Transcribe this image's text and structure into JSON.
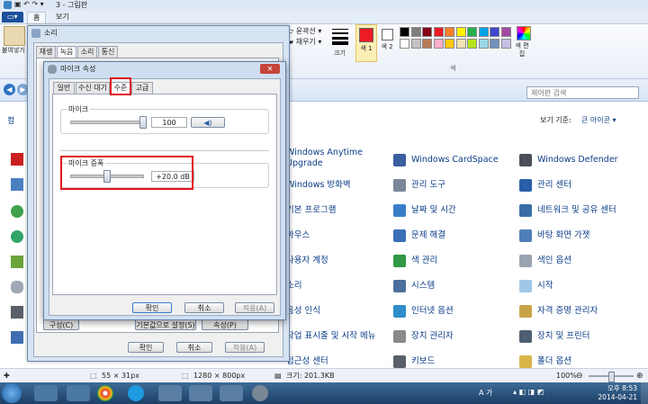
{
  "paint": {
    "title": "3 - 그림판",
    "tabs": [
      "홈",
      "보기"
    ],
    "paste_label": "붙여넣기",
    "outline_label": "윤곽선",
    "fill_label": "채우기",
    "size_label": "크기",
    "color1_label": "색 1",
    "color2_label": "색 2",
    "color_group_label": "색",
    "edit_colors_label": "색 편집",
    "colors_row1": [
      "#000000",
      "#7f7f7f",
      "#880015",
      "#ed1c24",
      "#ff7f27",
      "#fff200",
      "#22b14c",
      "#00a2e8",
      "#3f48cc",
      "#a349a4"
    ],
    "colors_row2": [
      "#ffffff",
      "#c3c3c3",
      "#b97a57",
      "#ffaec9",
      "#ffc90e",
      "#efe4b0",
      "#b5e61d",
      "#99d9ea",
      "#7092be",
      "#c8bfe7"
    ],
    "status_size1": "55 × 31px",
    "status_size2": "1280 × 800px",
    "status_filesize": "크기: 201.3KB",
    "zoom": "100%"
  },
  "control_panel": {
    "search_placeholder": "제어판 검색",
    "view_by": "보기 기준:",
    "view_mode": "큰 아이콘",
    "left_label": "컴",
    "col2": [
      "Windows Anytime Upgrade",
      "Windows 방화벽",
      "기본 프로그램",
      "마우스",
      "사용자 계정",
      "소리",
      "음성 인식",
      "작업 표시줄 및 시작 메뉴",
      "접근성 센터"
    ],
    "col3": [
      "Windows CardSpace",
      "관리 도구",
      "날짜 및 시간",
      "문제 해결",
      "색 관리",
      "시스템",
      "인터넷 옵션",
      "장치 관리자",
      "키보드"
    ],
    "col4": [
      "Windows Defender",
      "관리 센터",
      "네트워크 및 공유 센터",
      "바탕 화면 가젯",
      "색인 옵션",
      "시작",
      "자격 증명 관리자",
      "장치 및 프린터",
      "폴더 옵션"
    ]
  },
  "sound_dialog": {
    "title": "소리",
    "tabs": [
      "재생",
      "녹음",
      "소리",
      "통신"
    ],
    "configure_label": "구성(C)",
    "set_default_label": "기본값으로 설정(S)",
    "properties_label": "속성(P)",
    "ok_label": "확인",
    "cancel_label": "취소",
    "apply_label": "적용(A)"
  },
  "mic_dialog": {
    "title": "마이크 속성",
    "tabs": [
      "일반",
      "수신 대기",
      "수준",
      "고급"
    ],
    "mic_group_label": "마이크",
    "mic_value": "100",
    "boost_group_label": "마이크 증폭",
    "boost_value": "+20.0 dB",
    "mic_level_fraction": 1.0,
    "boost_level_fraction": 0.5,
    "ok_label": "확인",
    "cancel_label": "취소",
    "apply_label": "적용(A)"
  },
  "taskbar": {
    "lang": "A 가",
    "time": "오후 8:53",
    "date": "2014-04-21"
  }
}
